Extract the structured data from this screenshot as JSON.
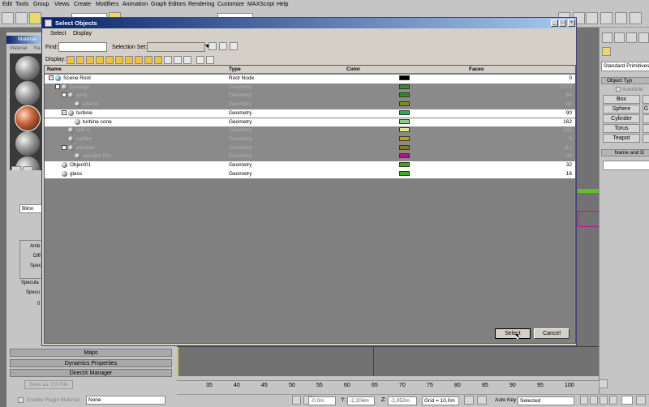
{
  "menubar": [
    "Edit",
    "Tools",
    "Group",
    "Views",
    "Create",
    "Modifiers",
    "Animation",
    "Graph Editors",
    "Rendering",
    "Customize",
    "MAXScript",
    "Help"
  ],
  "material_editor": {
    "title": "Material",
    "menu": [
      "Material",
      "Na"
    ],
    "type_field": "Blinn",
    "labels": {
      "ambient": "Amb",
      "diffuse": "Diff",
      "specular": "Spec",
      "specular_highlights": "Specula",
      "specular_level": "Specu",
      "zero": "0"
    }
  },
  "left_rollouts": [
    "Maps",
    "Dynamics Properties",
    "DirectX Manager"
  ],
  "left_buttons": {
    "save_fx": "Save as .FX File",
    "enable_plugin": "Enable Plugin Material",
    "plugin_value": "None"
  },
  "command_panel": {
    "dropdown": "Standard Primitives",
    "rollout_object_type": "Object Typ",
    "autogrid": "AutoGrid",
    "buttons": [
      "Box",
      "Sphere",
      "Cylinder",
      "Torus",
      "Teapot"
    ],
    "extra_buttons": [
      "",
      "G",
      "",
      "",
      ""
    ],
    "rollout_name": "Name and D"
  },
  "dialog": {
    "title": "Select Objects",
    "menu": [
      "Select",
      "Display"
    ],
    "find_label": "Find:",
    "find_value": "",
    "selection_set_label": "Selection Set:",
    "selection_set_value": "",
    "display_label": "Display:",
    "columns": [
      "Name",
      "Type",
      "Color",
      "Faces"
    ],
    "rows": [
      {
        "name": "Scene Root",
        "type": "Root Node",
        "color": "#000000",
        "faces": "0",
        "state": "sel",
        "depth": 0,
        "icon": "scene-root-icon"
      },
      {
        "name": "fuselage",
        "type": "Geometry",
        "color": "#3e8a1e",
        "faces": "1072",
        "state": "dim",
        "depth": 1
      },
      {
        "name": "wing",
        "type": "Geometry",
        "color": "#2f8f1c",
        "faces": "84",
        "state": "dim",
        "depth": 2
      },
      {
        "name": "aileron",
        "type": "Geometry",
        "color": "#7a8f17",
        "faces": "40",
        "state": "dim",
        "depth": 3
      },
      {
        "name": "turbine",
        "type": "Geometry",
        "color": "#22b05a",
        "faces": "90",
        "state": "sel",
        "depth": 2
      },
      {
        "name": "turbine cone",
        "type": "Geometry",
        "color": "#8ad07a",
        "faces": "162",
        "state": "sel",
        "depth": 3
      },
      {
        "name": "tailFin",
        "type": "Geometry",
        "color": "#e1e892",
        "faces": "105",
        "state": "dim",
        "depth": 2
      },
      {
        "name": "rudder",
        "type": "Geometry",
        "color": "#c59a1c",
        "faces": "8",
        "state": "dim",
        "depth": 2
      },
      {
        "name": "elevator",
        "type": "Geometry",
        "color": "#8a7a20",
        "faces": "112",
        "state": "dim",
        "depth": 2
      },
      {
        "name": "elevator fins",
        "type": "Geometry",
        "color": "#b0157a",
        "faces": "40",
        "state": "dim",
        "depth": 3
      },
      {
        "name": "Object01",
        "type": "Geometry",
        "color": "#3fa61c",
        "faces": "32",
        "state": "sel",
        "depth": 1
      },
      {
        "name": "glass",
        "type": "Geometry",
        "color": "#35b51a",
        "faces": "16",
        "state": "sel",
        "depth": 1
      }
    ],
    "select_button": "Select",
    "cancel_button": "Cancel"
  },
  "timeline": {
    "ticks": [
      "35",
      "40",
      "45",
      "50",
      "55",
      "60",
      "65",
      "70",
      "75",
      "80",
      "85",
      "90",
      "95",
      "100"
    ]
  },
  "status": {
    "x_label": "X:",
    "x_value": "-0,0m",
    "y_label": "Y:",
    "y_value": "-2,204m",
    "z_label": "Z:",
    "z_value": "-2,052m",
    "grid": "Grid = 10,0m",
    "autokey": "Auto Key",
    "autokey_value": "Selected"
  }
}
